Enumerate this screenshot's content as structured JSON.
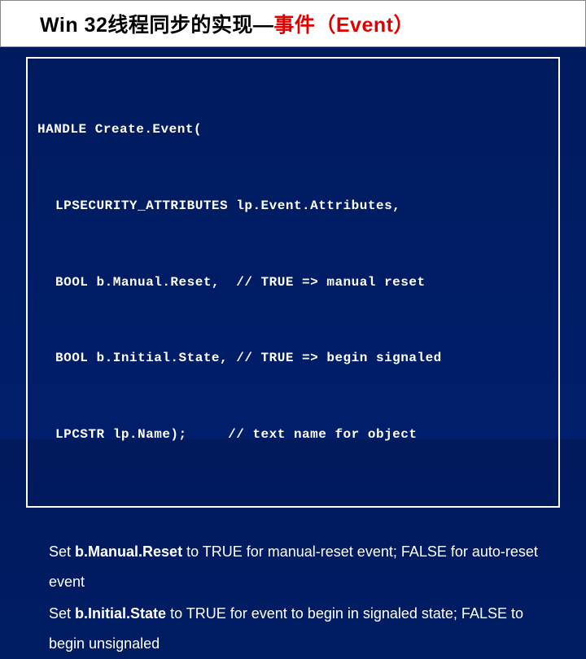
{
  "title": {
    "prefix": "Win 32线程同步的实现—",
    "highlight": "事件（Event）"
  },
  "code": {
    "l1": "HANDLE Create.Event(",
    "l2": "LPSECURITY_ATTRIBUTES lp.Event.Attributes,",
    "l3": "BOOL b.Manual.Reset,  // TRUE => manual reset",
    "l4": "BOOL b.Initial.State, // TRUE => begin signaled",
    "l5": "LPCSTR lp.Name);     // text name for object"
  },
  "desc": {
    "p1a": "Set ",
    "p1b": "b.Manual.Reset",
    "p1c": " to TRUE for manual-reset event; FALSE for auto-reset event",
    "p2a": "Set ",
    "p2b": "b.Initial.State",
    "p2c": " to TRUE for event to begin in signaled state; FALSE to begin unsignaled"
  }
}
